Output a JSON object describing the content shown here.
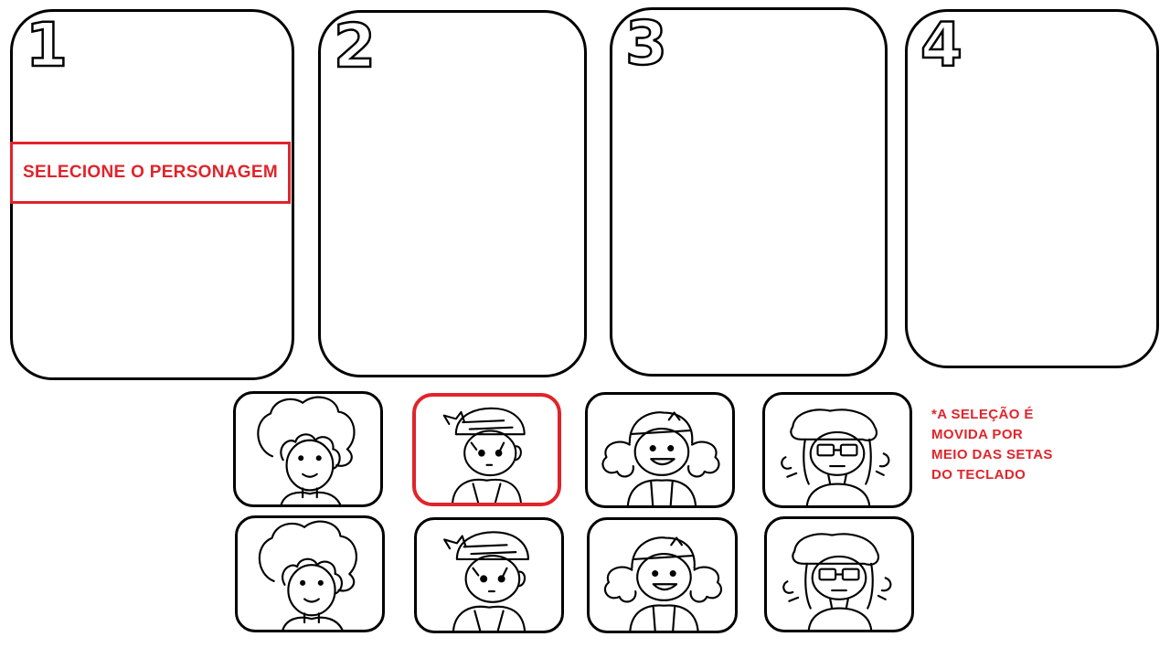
{
  "slots": [
    {
      "number": "1"
    },
    {
      "number": "2"
    },
    {
      "number": "3"
    },
    {
      "number": "4"
    }
  ],
  "select_prompt": "SELECIONE O PERSONAGEM",
  "hint_lines": [
    "*A SELEÇÃO É",
    "MOVIDA POR",
    "MEIO DAS SETAS",
    "DO TECLADO"
  ],
  "characters": [
    {
      "name": "curly-hair-character-portrait"
    },
    {
      "name": "cap-boy-character-portrait",
      "selected": true
    },
    {
      "name": "headband-girl-character-portrait"
    },
    {
      "name": "glasses-girl-character-portrait"
    }
  ],
  "colors": {
    "accent": "#e0242b",
    "ink": "#000000",
    "background": "#ffffff"
  }
}
